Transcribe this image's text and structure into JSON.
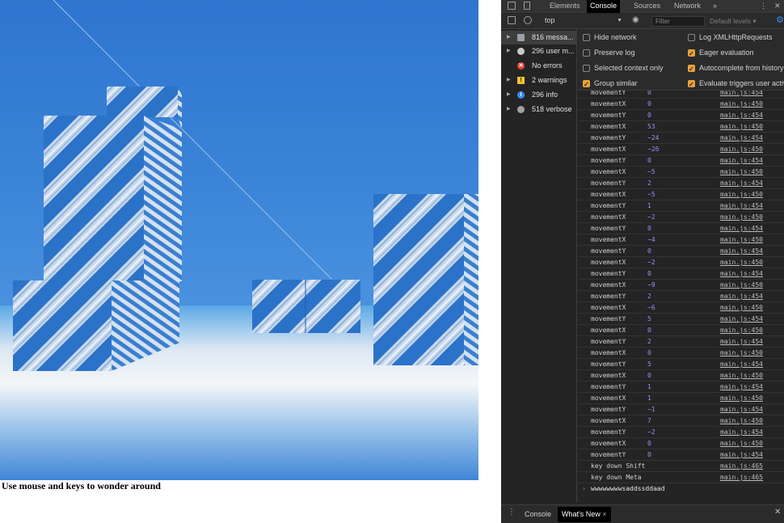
{
  "page": {
    "caption": "Use mouse and keys to wonder around"
  },
  "devtools": {
    "tabs": [
      "Elements",
      "Console",
      "Sources",
      "Network"
    ],
    "active_tab": "Console",
    "more_tabs_label": "»",
    "context": "top",
    "filter_placeholder": "Filter",
    "levels_label": "Default levels ▾",
    "sidebar": [
      {
        "label": "816 messa...",
        "icon": "list-icon",
        "color": "#9aa0a6"
      },
      {
        "label": "296 user m...",
        "icon": "user-icon",
        "color": "#c8c8c8"
      },
      {
        "label": "No errors",
        "icon": "error-icon",
        "color": "#e8443a"
      },
      {
        "label": "2 warnings",
        "icon": "warning-icon",
        "color": "#f2c12e"
      },
      {
        "label": "296 info",
        "icon": "info-icon",
        "color": "#3b8ef0"
      },
      {
        "label": "518 verbose",
        "icon": "bug-icon",
        "color": "#a0a0a0"
      }
    ],
    "settings_left": [
      {
        "label": "Hide network",
        "checked": false
      },
      {
        "label": "Preserve log",
        "checked": false
      },
      {
        "label": "Selected context only",
        "checked": false
      },
      {
        "label": "Group similar",
        "checked": true
      }
    ],
    "settings_right": [
      {
        "label": "Log XMLHttpRequests",
        "checked": false
      },
      {
        "label": "Eager evaluation",
        "checked": true
      },
      {
        "label": "Autocomplete from history",
        "checked": true
      },
      {
        "label": "Evaluate triggers user activ",
        "checked": true
      }
    ],
    "logs": [
      {
        "name": "movementY",
        "value": "0",
        "source": "main.js:454"
      },
      {
        "name": "movementX",
        "value": "0",
        "source": "main.js:450"
      },
      {
        "name": "movementY",
        "value": "0",
        "source": "main.js:454"
      },
      {
        "name": "movementX",
        "value": "53",
        "source": "main.js:450"
      },
      {
        "name": "movementY",
        "value": "−24",
        "source": "main.js:454"
      },
      {
        "name": "movementX",
        "value": "−26",
        "source": "main.js:450"
      },
      {
        "name": "movementY",
        "value": "0",
        "source": "main.js:454"
      },
      {
        "name": "movementX",
        "value": "−5",
        "source": "main.js:450"
      },
      {
        "name": "movementY",
        "value": "2",
        "source": "main.js:454"
      },
      {
        "name": "movementX",
        "value": "−5",
        "source": "main.js:450"
      },
      {
        "name": "movementY",
        "value": "1",
        "source": "main.js:454"
      },
      {
        "name": "movementX",
        "value": "−2",
        "source": "main.js:450"
      },
      {
        "name": "movementY",
        "value": "0",
        "source": "main.js:454"
      },
      {
        "name": "movementX",
        "value": "−4",
        "source": "main.js:450"
      },
      {
        "name": "movementY",
        "value": "0",
        "source": "main.js:454"
      },
      {
        "name": "movementX",
        "value": "−2",
        "source": "main.js:450"
      },
      {
        "name": "movementY",
        "value": "0",
        "source": "main.js:454"
      },
      {
        "name": "movementX",
        "value": "−9",
        "source": "main.js:450"
      },
      {
        "name": "movementY",
        "value": "2",
        "source": "main.js:454"
      },
      {
        "name": "movementX",
        "value": "−6",
        "source": "main.js:450"
      },
      {
        "name": "movementY",
        "value": "5",
        "source": "main.js:454"
      },
      {
        "name": "movementX",
        "value": "0",
        "source": "main.js:450"
      },
      {
        "name": "movementY",
        "value": "2",
        "source": "main.js:454"
      },
      {
        "name": "movementX",
        "value": "0",
        "source": "main.js:450"
      },
      {
        "name": "movementY",
        "value": "5",
        "source": "main.js:454"
      },
      {
        "name": "movementX",
        "value": "0",
        "source": "main.js:450"
      },
      {
        "name": "movementY",
        "value": "1",
        "source": "main.js:454"
      },
      {
        "name": "movementX",
        "value": "1",
        "source": "main.js:450"
      },
      {
        "name": "movementY",
        "value": "−1",
        "source": "main.js:454"
      },
      {
        "name": "movementX",
        "value": "7",
        "source": "main.js:450"
      },
      {
        "name": "movementY",
        "value": "−2",
        "source": "main.js:454"
      },
      {
        "name": "movementX",
        "value": "0",
        "source": "main.js:450"
      },
      {
        "name": "movementY",
        "value": "0",
        "source": "main.js:454"
      },
      {
        "name": "key down Shift",
        "value": "",
        "source": "main.js:465"
      },
      {
        "name": "key down Meta",
        "value": "",
        "source": "main.js:465"
      }
    ],
    "prompt_text": "wwwwwwwwsaddssddaad",
    "drawer_tabs": [
      "Console",
      "What's New"
    ],
    "drawer_active": "What's New"
  },
  "colors": {
    "sky": "#2f78d2",
    "block_blue": "#2b72c9",
    "stripe_light": "#c9d9ec",
    "floor": "#e8eef6",
    "accent": "#3b8ef0"
  }
}
